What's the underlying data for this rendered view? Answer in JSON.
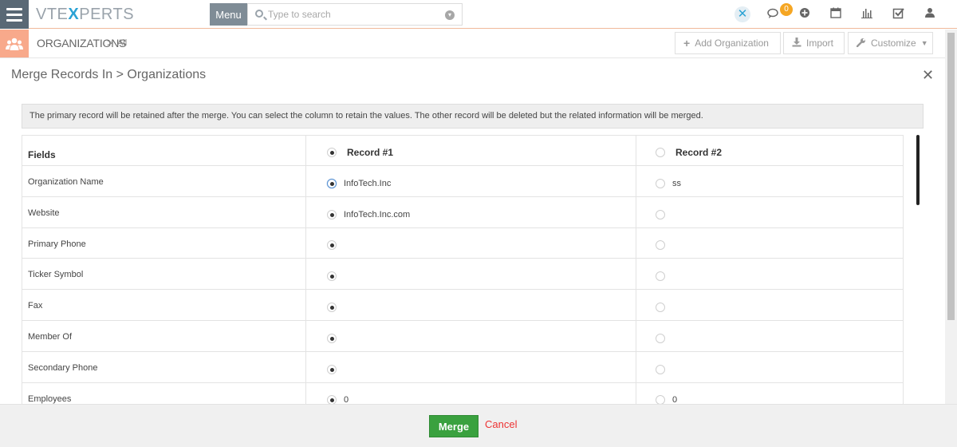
{
  "topbar": {
    "logo_prefix": "VTE",
    "logo_x": "X",
    "logo_suffix": "PERTS",
    "menu_label": "Menu",
    "search_placeholder": "Type to search",
    "notification_count": "0"
  },
  "module": {
    "title": "ORGANIZATIONS",
    "separator": ">",
    "breadcrumb": "All",
    "buttons": {
      "add": "Add Organization",
      "import": "Import",
      "customize": "Customize"
    }
  },
  "modal": {
    "title": "Merge Records In > Organizations",
    "info": "The primary record will be retained after the merge. You can select the column to retain the values. The other record will be deleted but the related information will be merged.",
    "headers": {
      "fields": "Fields",
      "record1": "Record #1",
      "record2": "Record #2"
    },
    "rows": [
      {
        "field": "Organization Name",
        "r1": "InfoTech.Inc",
        "r2": "ss"
      },
      {
        "field": "Website",
        "r1": "InfoTech.Inc.com",
        "r2": ""
      },
      {
        "field": "Primary Phone",
        "r1": "",
        "r2": ""
      },
      {
        "field": "Ticker Symbol",
        "r1": "",
        "r2": ""
      },
      {
        "field": "Fax",
        "r1": "",
        "r2": ""
      },
      {
        "field": "Member Of",
        "r1": "",
        "r2": ""
      },
      {
        "field": "Secondary Phone",
        "r1": "",
        "r2": ""
      },
      {
        "field": "Employees",
        "r1": "0",
        "r2": "0"
      }
    ],
    "merge_label": "Merge",
    "cancel_label": "Cancel"
  },
  "colors": {
    "accent": "#f8a98b",
    "merge": "#3aa13f",
    "cancel": "#ee3333",
    "menu": "#7f8c96"
  },
  "icons": [
    "menu-icon",
    "search-icon",
    "dropdown-icon",
    "vtexperts-icon",
    "chat-icon",
    "plus-circle-icon",
    "calendar-icon",
    "reports-icon",
    "tasks-icon",
    "user-icon",
    "organizations-icon",
    "plus-icon",
    "download-icon",
    "wrench-icon",
    "caret-down-icon",
    "close-icon"
  ]
}
